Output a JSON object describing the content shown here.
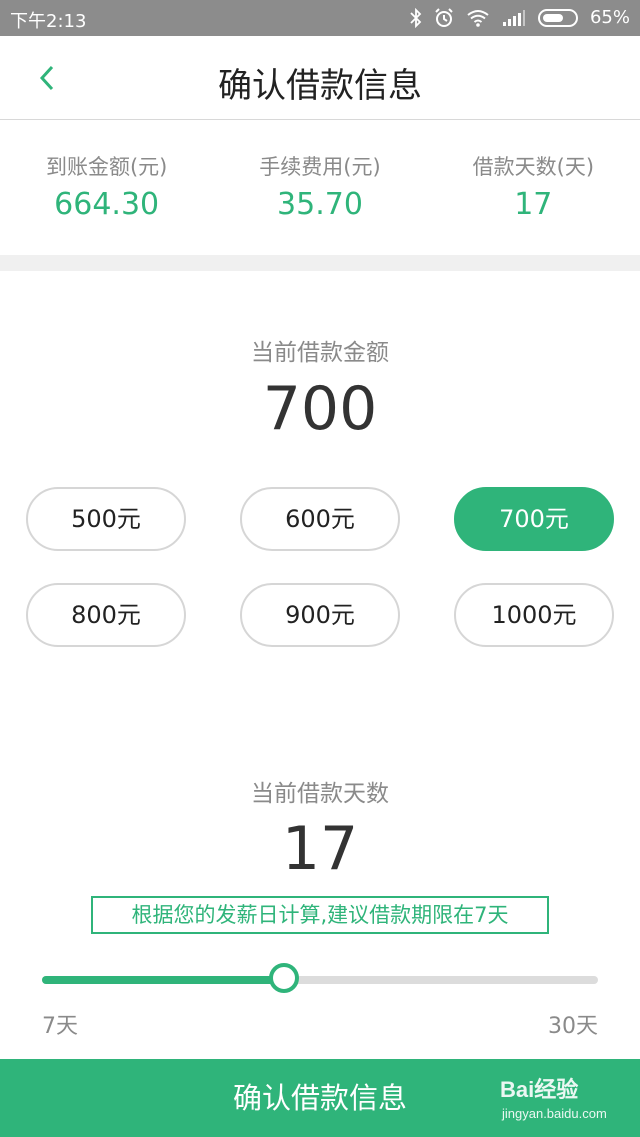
{
  "status_bar": {
    "time": "下午2:13",
    "battery_text": "65%",
    "battery_level": 0.65,
    "icons": [
      "bluetooth-icon",
      "alarm-icon",
      "wifi-icon",
      "signal-icon",
      "battery-icon"
    ]
  },
  "header": {
    "back_icon": "chevron-left-icon",
    "title": "确认借款信息"
  },
  "summary": {
    "received": {
      "label": "到账金额(元)",
      "value": "664.30"
    },
    "fee": {
      "label": "手续费用(元)",
      "value": "35.70"
    },
    "days": {
      "label": "借款天数(天)",
      "value": "17"
    }
  },
  "amount": {
    "label": "当前借款金额",
    "value": "700",
    "options": [
      "500元",
      "600元",
      "700元",
      "800元",
      "900元",
      "1000元"
    ],
    "selected": "700元"
  },
  "term": {
    "label": "当前借款天数",
    "value": "17",
    "tip": "根据您的发薪日计算,建议借款期限在7天",
    "slider": {
      "min": 7,
      "max": 30,
      "value": 17,
      "min_label": "7天",
      "max_label": "30天"
    }
  },
  "confirm_button": {
    "label": "确认借款信息"
  },
  "watermark": {
    "text": "Bai经验",
    "sub": "jingyan.baidu.com"
  },
  "colors": {
    "accent": "#2fb47a",
    "status_bar": "#8c8c8c",
    "muted_text": "#8a8a8a"
  }
}
